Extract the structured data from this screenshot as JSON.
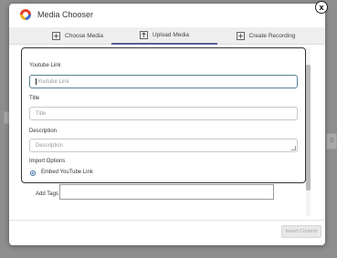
{
  "window": {
    "title": "Media Chooser",
    "close_label": "x"
  },
  "tabs": [
    {
      "label": "Choose Media",
      "icon": "plus-square-icon"
    },
    {
      "label": "Upload Media",
      "icon": "upload-icon",
      "active": true
    },
    {
      "label": "Create Recording",
      "icon": "plus-square-icon"
    }
  ],
  "form": {
    "youtube_link": {
      "label": "Youtube Link",
      "value": "",
      "placeholder": "Youtube Link"
    },
    "title": {
      "label": "Title",
      "value": "",
      "placeholder": "Title"
    },
    "description": {
      "label": "Description",
      "value": "",
      "placeholder": "Description"
    },
    "import_options": {
      "label": "Import Options",
      "selected": "Embed YouTube Link"
    },
    "add_tags": {
      "label": "Add Tags",
      "value": ""
    }
  },
  "footer": {
    "insert_label": "Insert Content"
  },
  "background": {
    "right_fragment": "S"
  },
  "colors": {
    "active_tab_underline": "#5b5b9a",
    "radio": "#3b6ea5",
    "active_border": "#5a7f93"
  }
}
